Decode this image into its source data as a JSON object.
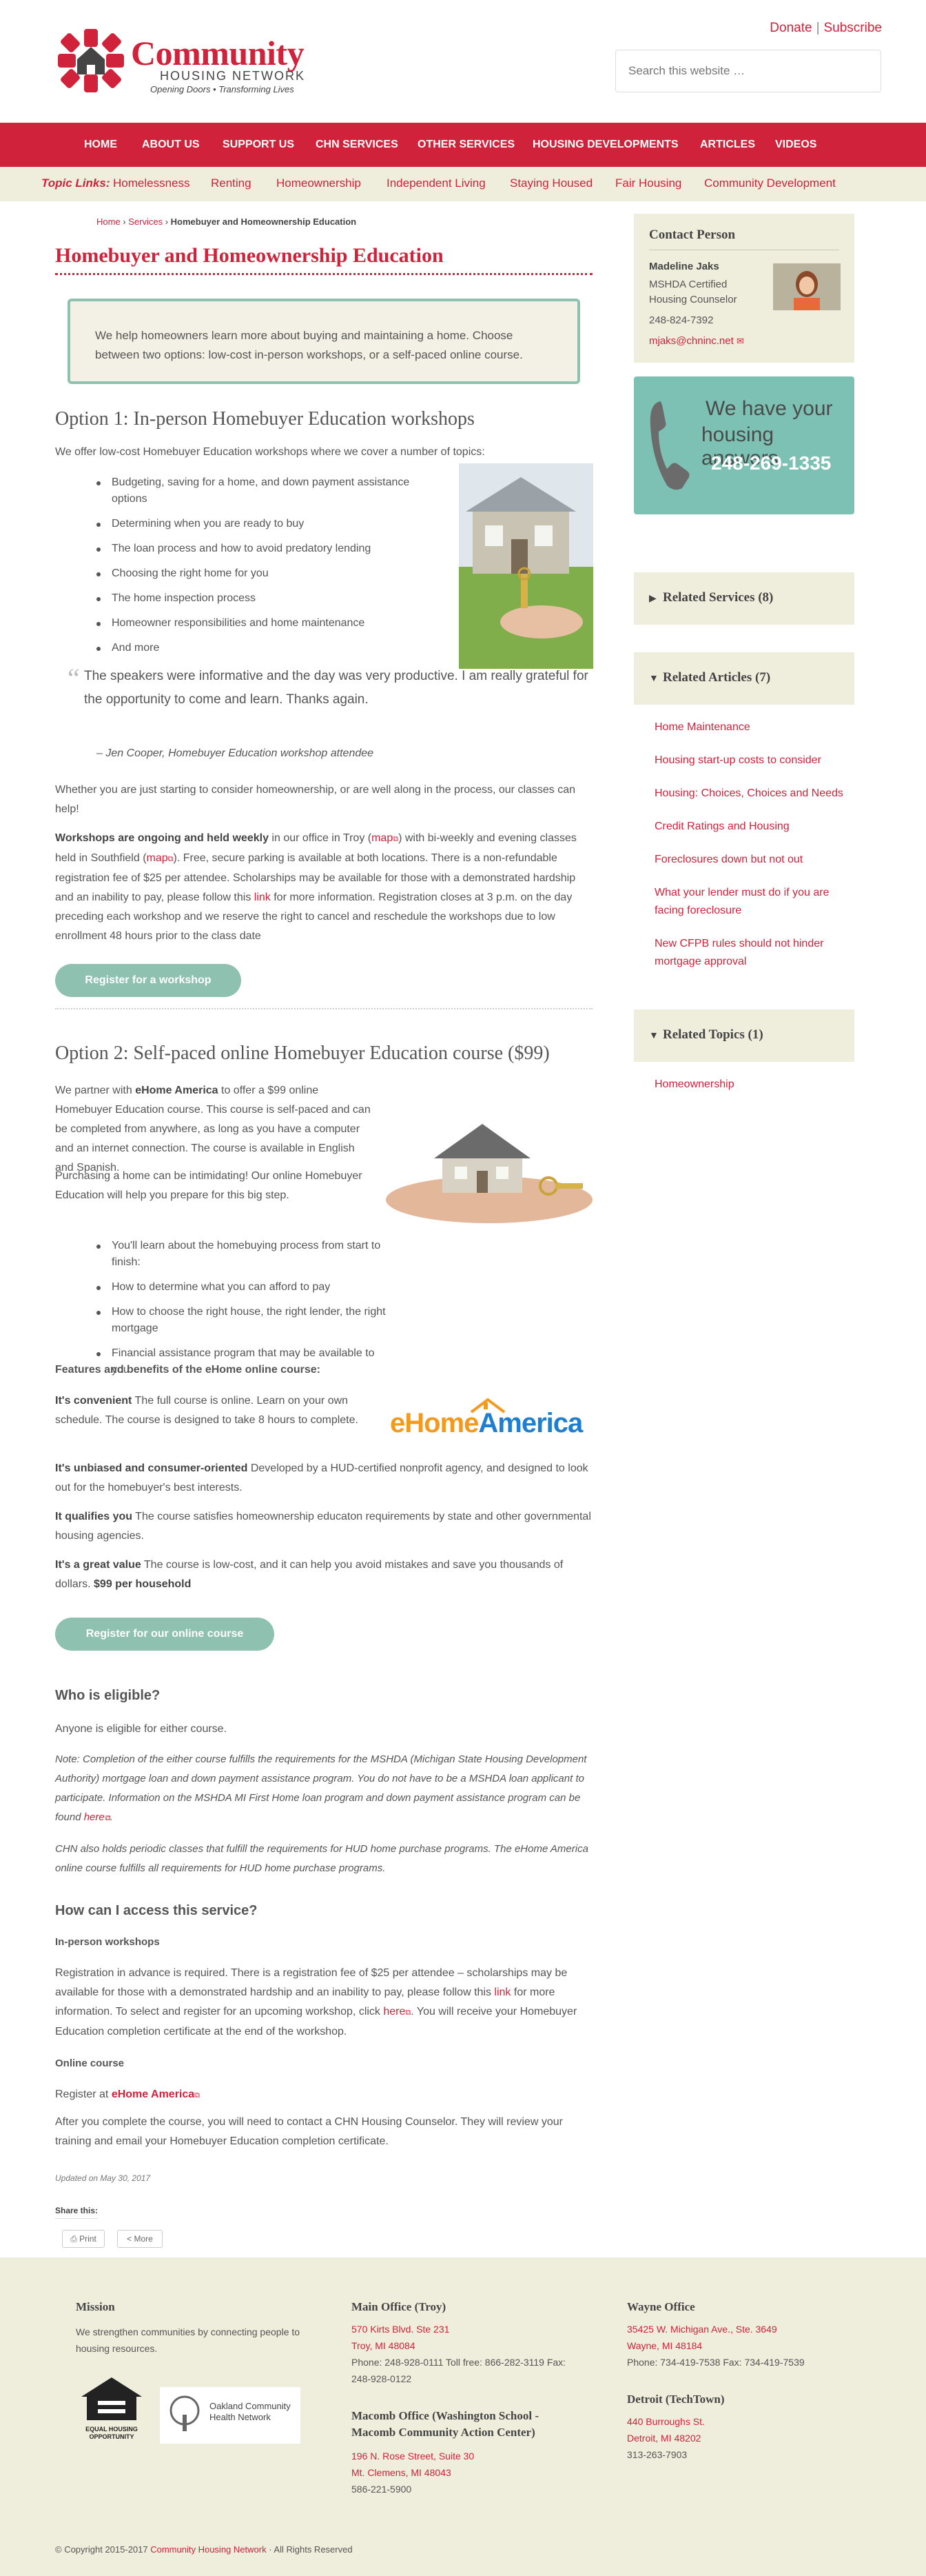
{
  "header": {
    "logo_title": "Community",
    "logo_sub": "HOUSING NETWORK",
    "logo_tag": "Opening Doors • Transforming Lives",
    "donate": "Donate",
    "subscribe": "Subscribe",
    "search_placeholder": "Search this website …"
  },
  "nav": [
    "HOME",
    "ABOUT US",
    "SUPPORT US",
    "CHN SERVICES",
    "OTHER SERVICES",
    "HOUSING DEVELOPMENTS",
    "ARTICLES",
    "VIDEOS"
  ],
  "topics": {
    "label": "Topic Links:",
    "items": [
      "Homelessness",
      "Renting",
      "Homeownership",
      "Independent Living",
      "Staying Housed",
      "Fair Housing",
      "Community Development"
    ]
  },
  "breadcrumb": {
    "home": "Home",
    "services": "Services",
    "current": "Homebuyer and Homeownership Education"
  },
  "page_title": "Homebuyer and Homeownership Education",
  "intro": "We help homeowners learn more about buying and maintaining a home. Choose between two options: low-cost in-person workshops, or a self-paced online course.",
  "option1": {
    "title": "Option 1: In-person Homebuyer Education workshops",
    "lead": "We offer low-cost Homebuyer Education workshops where we cover a number of topics:",
    "topics": [
      "Budgeting, saving for a home, and down payment assistance options",
      "Determining when you are ready to buy",
      "The loan process and how to avoid predatory lending",
      "Choosing the right home for you",
      "The home inspection process",
      "Homeowner responsibilities and home maintenance",
      "And more"
    ],
    "quote": "The speakers were informative and the day was very productive. I am really grateful for the opportunity to come and learn. Thanks again.",
    "quote_attr": "– Jen Cooper, Homebuyer Education workshop attendee",
    "para1": "Whether you are just starting to consider homeownership, or are well along in the process, our classes can help!",
    "para2_bold": "Workshops are ongoing and held weekly",
    "para2_a": " in our office in Troy (",
    "para2_map1": "map",
    "para2_b": ") with bi-weekly and evening classes held in Southfield (",
    "para2_map2": "map",
    "para2_c": "). Free, secure parking is available at both locations. There is a non-refundable registration fee of $25 per attendee. Scholarships may be available for those with a demonstrated hardship and an inability to pay, please follow this ",
    "para2_link": "link",
    "para2_d": " for more information. Registration closes at 3 p.m. on the day preceding each workshop and we reserve the right to cancel and reschedule the workshops due to low enrollment 48 hours prior to the class date",
    "button": "Register for a workshop"
  },
  "option2": {
    "title": "Option 2: Self-paced online Homebuyer Education course ($99)",
    "para1_a": "We partner with ",
    "para1_bold": "eHome America",
    "para1_b": " to offer a $99 online Homebuyer Education course. This course is self-paced and can be completed from anywhere, as long as you have a computer and an internet connection. The course is available in English and Spanish.",
    "para2": "Purchasing a home can be intimidating! Our online Homebuyer Education will help you prepare for this big step.",
    "bullets": [
      "You'll learn about the homebuying process from start to finish:",
      "How to determine what you can afford to pay",
      "How to choose the right house, the right lender, the right mortgage",
      "Financial assistance program that may be available to you"
    ],
    "features_title": "Features and benefits of the eHome online course:",
    "f1_bold": "It's convenient",
    "f1": "  The full course is online. Learn on your own schedule. The course is designed to take 8 hours to complete.",
    "f2_bold": "It's unbiased and consumer-oriented",
    "f2": " Developed by a HUD-certified nonprofit agency, and designed to look out for the homebuyer's best interests.",
    "f3_bold": "It qualifies you",
    "f3": " The course satisfies homeownership educaton requirements by state and other governmental housing agencies.",
    "f4_bold": "It's a great value",
    "f4": " The course is low-cost, and it can help you avoid mistakes and save you thousands of dollars. ",
    "f4_price": "$99 per household",
    "ehome_logo": "eHomeAmerica",
    "button": "Register for our online course"
  },
  "eligible": {
    "title": "Who is eligible?",
    "text": "Anyone is eligible for either course.",
    "note1_a": "Note: Completion of the either course fulfills the requirements for the MSHDA (Michigan State Housing Development Authority) mortgage loan and down payment assistance program. You do not have to be a MSHDA loan applicant to participate. Information on the MSHDA MI First Home loan program and down payment assistance program can be found ",
    "note1_link": "here",
    "note1_b": ".",
    "note2": "CHN also holds periodic classes that fulfill the requirements for HUD home purchase programs. The eHome America online course fulfills all requirements for HUD home purchase programs."
  },
  "access": {
    "title": "How can I access this service?",
    "inperson_title": "In-person workshops",
    "inperson_a": "Registration in advance is required.  There is a registration fee of $25 per attendee – scholarships may be available for those with a demonstrated hardship and an inability to pay, please follow this ",
    "inperson_link": "link",
    "inperson_b": " for more information. To select and register for an upcoming workshop, click ",
    "inperson_here": "here",
    "inperson_c": ". You will receive your Homebuyer Education completion certificate at the end of the workshop.",
    "online_title": "Online course",
    "online_a": "Register at ",
    "online_link": "eHome America",
    "online_b": "After you complete the course, you will need to contact a CHN Housing Counselor. They will review your training and email your Homebuyer Education completion certificate."
  },
  "updated": "Updated on May 30, 2017",
  "share": {
    "label": "Share this:",
    "print": "Print",
    "more": "More"
  },
  "sidebar": {
    "contact_title": "Contact Person",
    "contact_name": "Madeline Jaks",
    "contact_role_1": "MSHDA Certified",
    "contact_role_2": "Housing Counselor",
    "contact_phone": "248-824-7392",
    "contact_email": "mjaks@chninc.net",
    "banner_line1": "We have your",
    "banner_line2": "housing answers",
    "banner_phone": "248-269-1335",
    "related_services": "Related Services (8)",
    "related_articles": "Related Articles (7)",
    "articles": [
      "Home Maintenance",
      "Housing start-up costs to consider",
      "Housing: Choices, Choices and Needs",
      "Credit Ratings and Housing",
      "Foreclosures down but not out",
      "What your lender must do if you are facing foreclosure",
      "New CFPB rules should not hinder mortgage approval"
    ],
    "related_topics": "Related Topics (1)",
    "topics": [
      "Homeownership"
    ]
  },
  "footer": {
    "mission_title": "Mission",
    "mission_text": "We strengthen communities by connecting people to housing resources.",
    "eho_label": "EQUAL HOUSING OPPORTUNITY",
    "ocmhn_label": "Oakland Community Health Network",
    "troy_title": "Main Office (Troy)",
    "troy_addr1": "570 Kirts Blvd. Ste 231",
    "troy_addr2": "Troy, MI 48084",
    "troy_phone": "Phone: 248-928-0111 Toll free: 866-282-3119 Fax: 248-928-0122",
    "macomb_title": "Macomb Office (Washington School - Macomb Community Action Center)",
    "macomb_addr1": "196 N. Rose Street, Suite 30",
    "macomb_addr2": "Mt. Clemens, MI 48043",
    "macomb_phone": "586-221-5900",
    "wayne_title": "Wayne Office",
    "wayne_addr1": "35425 W. Michigan Ave., Ste. 3649",
    "wayne_addr2": "Wayne, MI 48184",
    "wayne_phone": "Phone: 734-419-7538 Fax: 734-419-7539",
    "detroit_title": "Detroit (TechTown)",
    "detroit_addr1": "440 Burroughs St.",
    "detroit_addr2": "Detroit, MI 48202",
    "detroit_phone": "313-263-7903",
    "copyright_a": "© Copyright 2015-2017 ",
    "copyright_link": "Community Housing Network",
    "copyright_b": " · All Rights Reserved"
  },
  "colors": {
    "brand_red": "#d0223a",
    "teal": "#8ec1b0",
    "beige": "#efeddc",
    "banner_teal": "#7cc1b3"
  }
}
